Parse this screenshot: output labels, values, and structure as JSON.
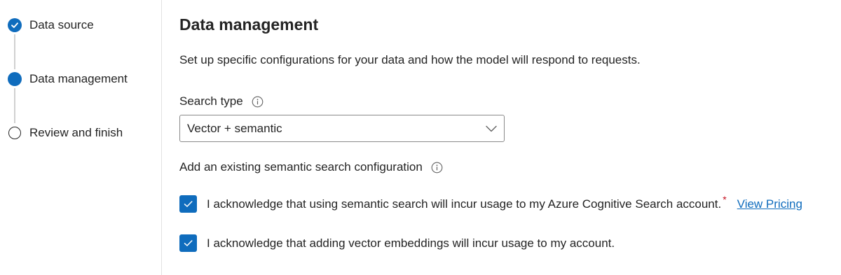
{
  "stepper": {
    "steps": [
      {
        "label": "Data source",
        "state": "completed"
      },
      {
        "label": "Data management",
        "state": "current"
      },
      {
        "label": "Review and finish",
        "state": "pending"
      }
    ]
  },
  "main": {
    "title": "Data management",
    "description": "Set up specific configurations for your data and how the model will respond to requests.",
    "search_type": {
      "label": "Search type",
      "selected": "Vector + semantic"
    },
    "semantic_config": {
      "label": "Add an existing semantic search configuration"
    },
    "acknowledgements": [
      {
        "text": "I acknowledge that using semantic search will incur usage to my Azure Cognitive Search account.",
        "required_marker": "*",
        "link": "View Pricing",
        "checked": true
      },
      {
        "text": "I acknowledge that adding vector embeddings will incur usage to my account.",
        "checked": true
      }
    ]
  },
  "colors": {
    "accent": "#0f6cbd",
    "required": "#c50f1f",
    "divider": "#e1e1e1"
  },
  "icons": [
    "checkmark-icon",
    "info-icon",
    "chevron-down-icon"
  ]
}
